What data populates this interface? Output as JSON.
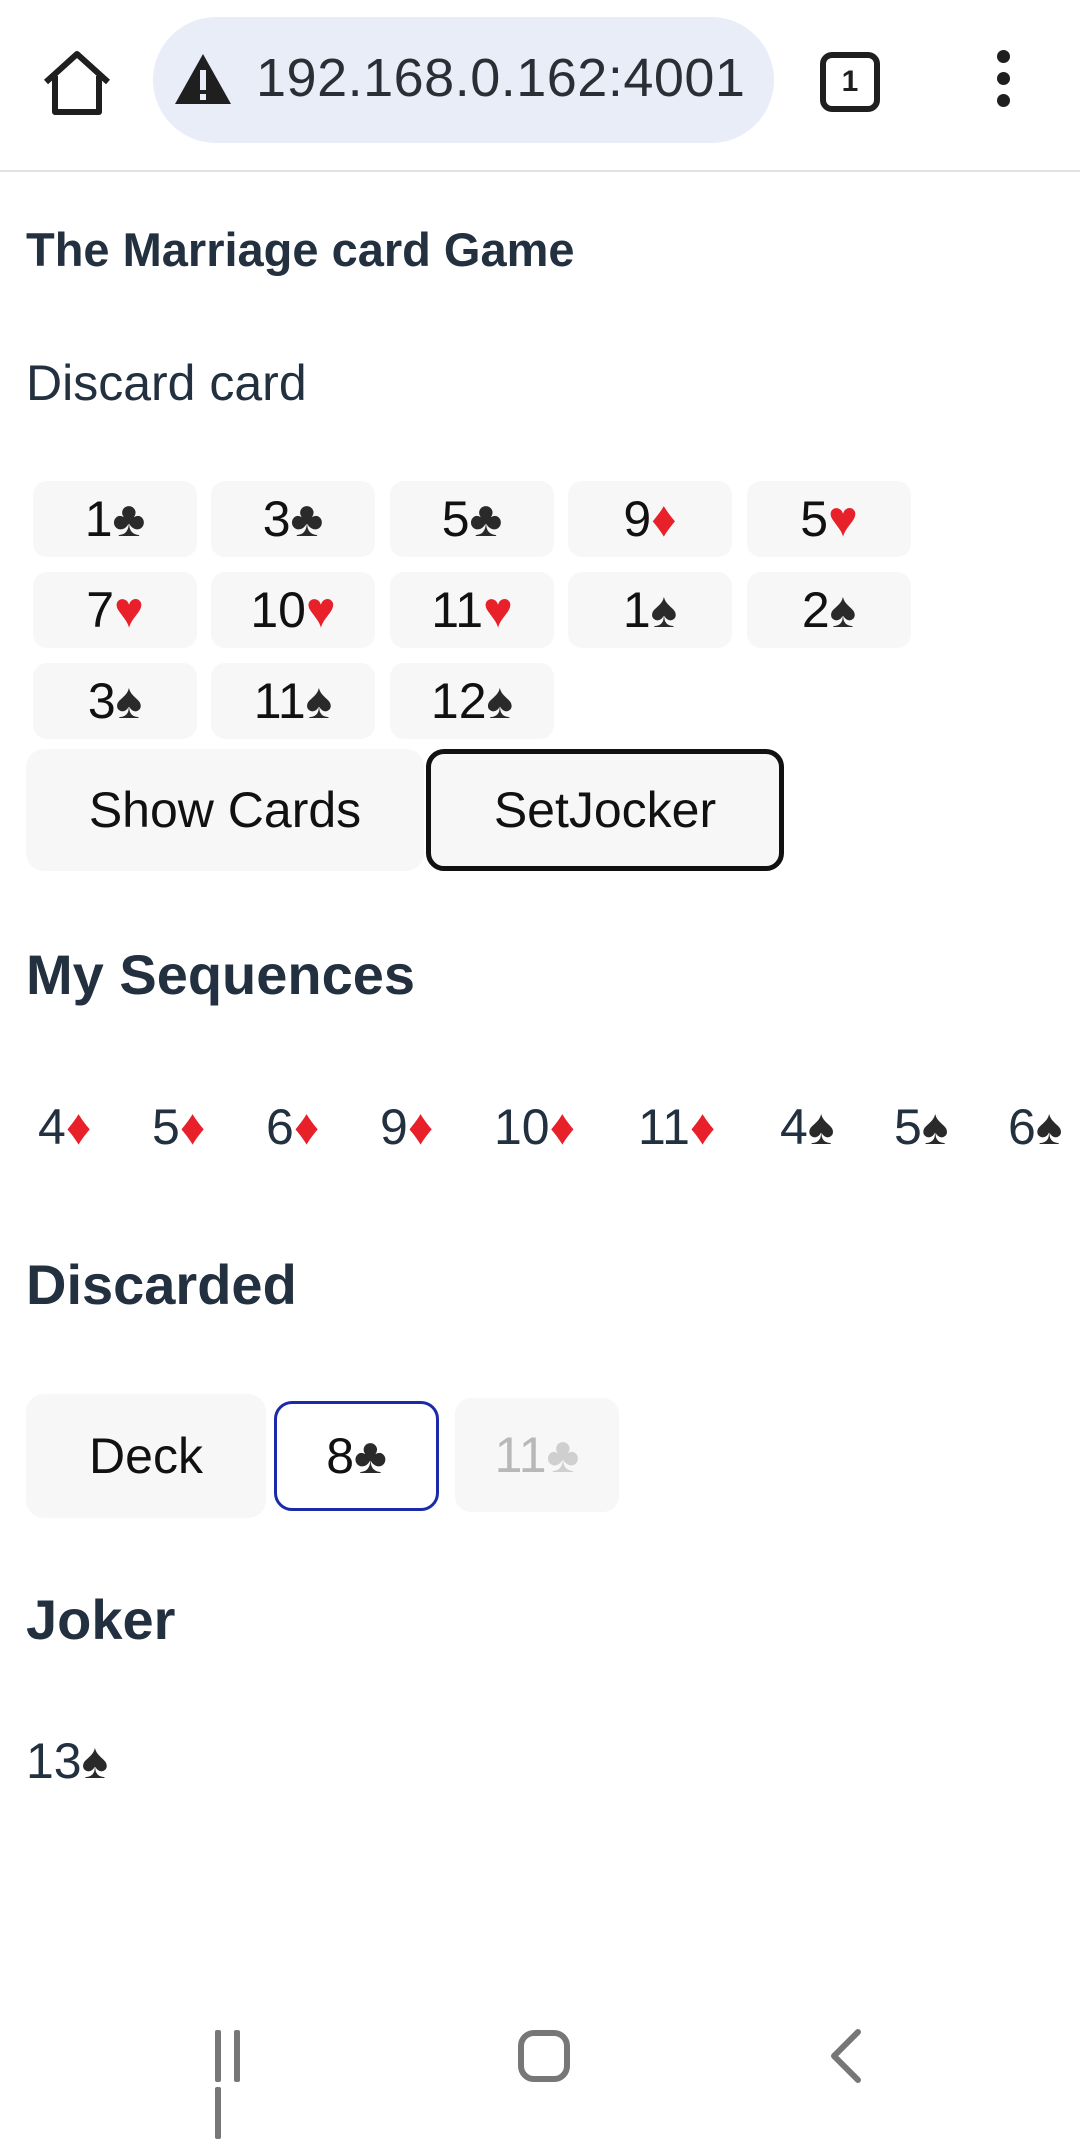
{
  "browser": {
    "url": "192.168.0.162:4001",
    "tab_count": "1"
  },
  "page": {
    "title": "The Marriage card Game",
    "subtitle": "Discard card"
  },
  "hand": [
    {
      "rank": "1",
      "suit": "♣",
      "color": "black"
    },
    {
      "rank": "3",
      "suit": "♣",
      "color": "black"
    },
    {
      "rank": "5",
      "suit": "♣",
      "color": "black"
    },
    {
      "rank": "9",
      "suit": "♦",
      "color": "red"
    },
    {
      "rank": "5",
      "suit": "♥",
      "color": "red"
    },
    {
      "rank": "7",
      "suit": "♥",
      "color": "red"
    },
    {
      "rank": "10",
      "suit": "♥",
      "color": "red"
    },
    {
      "rank": "11",
      "suit": "♥",
      "color": "red"
    },
    {
      "rank": "1",
      "suit": "♠",
      "color": "black"
    },
    {
      "rank": "2",
      "suit": "♠",
      "color": "black"
    },
    {
      "rank": "3",
      "suit": "♠",
      "color": "black"
    },
    {
      "rank": "11",
      "suit": "♠",
      "color": "black"
    },
    {
      "rank": "12",
      "suit": "♠",
      "color": "black"
    }
  ],
  "buttons": {
    "show_cards": "Show Cards",
    "set_jocker": "SetJocker"
  },
  "sequences": {
    "heading": "My Sequences",
    "items": [
      {
        "rank": "4",
        "suit": "♦",
        "color": "red"
      },
      {
        "rank": "5",
        "suit": "♦",
        "color": "red"
      },
      {
        "rank": "6",
        "suit": "♦",
        "color": "red"
      },
      {
        "rank": "9",
        "suit": "♦",
        "color": "red"
      },
      {
        "rank": "10",
        "suit": "♦",
        "color": "red"
      },
      {
        "rank": "11",
        "suit": "♦",
        "color": "red"
      },
      {
        "rank": "4",
        "suit": "♠",
        "color": "black"
      },
      {
        "rank": "5",
        "suit": "♠",
        "color": "black"
      },
      {
        "rank": "6",
        "suit": "♠",
        "color": "black"
      }
    ]
  },
  "discarded": {
    "heading": "Discarded",
    "deck_label": "Deck",
    "top_card": {
      "rank": "8",
      "suit": "♣"
    },
    "previous_card": {
      "rank": "11",
      "suit": "♣"
    }
  },
  "joker": {
    "heading": "Joker",
    "card": {
      "rank": "13",
      "suit": "♠"
    }
  },
  "colors": {
    "red_suit": "#e8202a",
    "black_suit": "#2a2a2a",
    "heading": "#22303f",
    "selected_border": "#1a2aa8"
  }
}
